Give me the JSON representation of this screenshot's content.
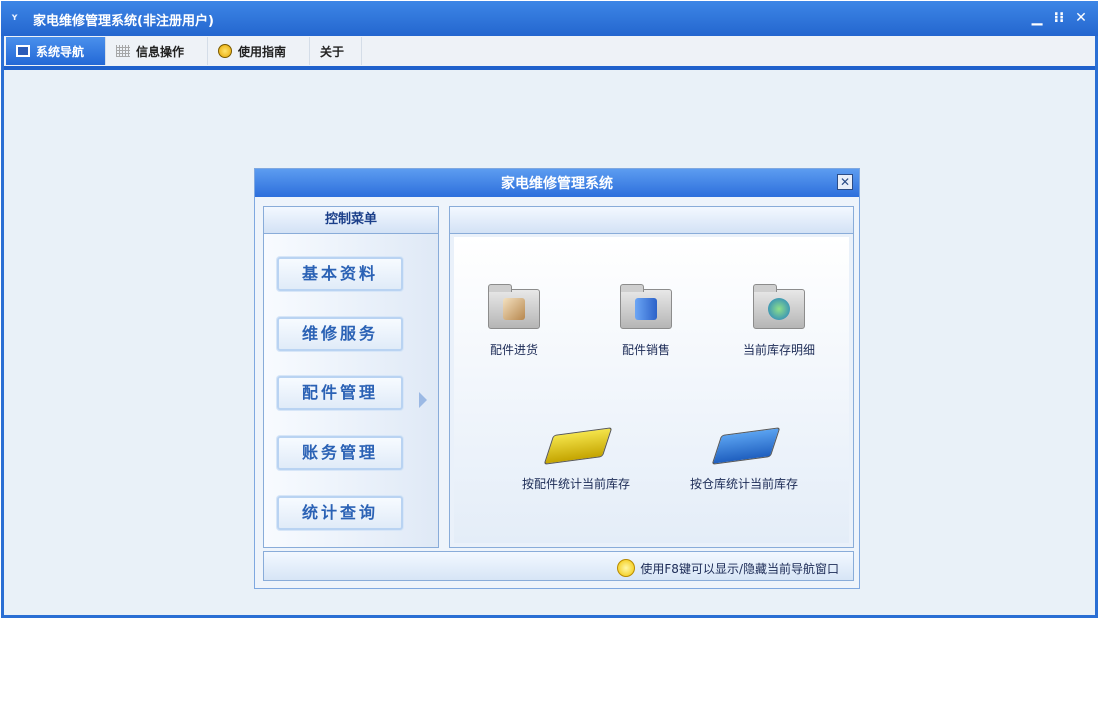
{
  "window": {
    "title": "家电维修管理系统(非注册用户)",
    "app_icon": "ʏ"
  },
  "menubar": {
    "tabs": [
      {
        "label": "系统导航",
        "icon": "monitor-icon"
      },
      {
        "label": "信息操作",
        "icon": "grid-icon"
      },
      {
        "label": "使用指南",
        "icon": "bulb-icon"
      },
      {
        "label": "关于"
      }
    ]
  },
  "dialog": {
    "title": "家电维修管理系统",
    "control_menu": {
      "header": "控制菜单",
      "items": [
        "基本资料",
        "维修服务",
        "配件管理",
        "账务管理",
        "统计查询"
      ]
    },
    "functions": [
      {
        "label": "配件进货",
        "icon": "brush-folder-icon"
      },
      {
        "label": "配件销售",
        "icon": "mac-folder-icon"
      },
      {
        "label": "当前库存明细",
        "icon": "globe-folder-icon"
      },
      {
        "label": "按配件统计当前库存",
        "icon": "yellow-book-icon"
      },
      {
        "label": "按仓库统计当前库存",
        "icon": "blue-book-icon"
      }
    ],
    "footer_tip": "使用F8键可以显示/隐藏当前导航窗口"
  },
  "colors": {
    "title_bar": "#2466cf",
    "accent": "#1f61cc",
    "nav_text": "#2b62b5"
  }
}
